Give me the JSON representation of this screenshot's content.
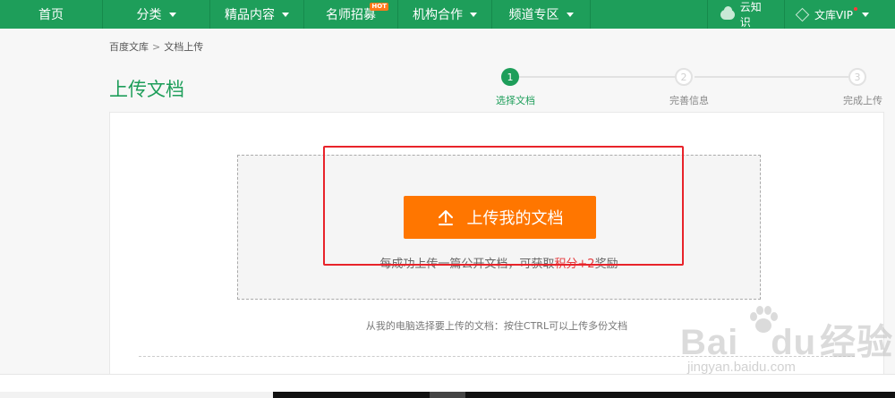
{
  "nav": {
    "items": [
      {
        "label": "首页",
        "caret": false,
        "hot": false
      },
      {
        "label": "分类",
        "caret": true,
        "hot": false
      },
      {
        "label": "精品内容",
        "caret": true,
        "hot": false
      },
      {
        "label": "名师招募",
        "caret": false,
        "hot": true
      },
      {
        "label": "机构合作",
        "caret": true,
        "hot": false
      },
      {
        "label": "频道专区",
        "caret": true,
        "hot": false
      }
    ],
    "hot_badge": "HOT",
    "cloud_label": "云知识",
    "vip_label": "文库VIP"
  },
  "breadcrumb": {
    "home": "百度文库",
    "separator": ">",
    "current": "文档上传"
  },
  "page": {
    "title": "上传文档"
  },
  "steps": [
    {
      "number": "1",
      "label": "选择文档",
      "active": true
    },
    {
      "number": "2",
      "label": "完善信息",
      "active": false
    },
    {
      "number": "3",
      "label": "完成上传",
      "active": false
    }
  ],
  "upload": {
    "button_label": "上传我的文档",
    "reward_prefix": "每成功上传一篇公开文档，可获取",
    "reward_points": "积分+2",
    "reward_suffix": "奖励",
    "hint": "从我的电脑选择要上传的文档：按住CTRL可以上传多份文档"
  },
  "watermark": {
    "brand_left": "Bai",
    "brand_right": "du",
    "brand_cn": "经验",
    "url": "jingyan.baidu.com"
  },
  "colors": {
    "nav_green": "#1e9e5a",
    "upload_orange": "#ff7600",
    "highlight_red": "#e8232a",
    "points_red": "#e5383b"
  }
}
